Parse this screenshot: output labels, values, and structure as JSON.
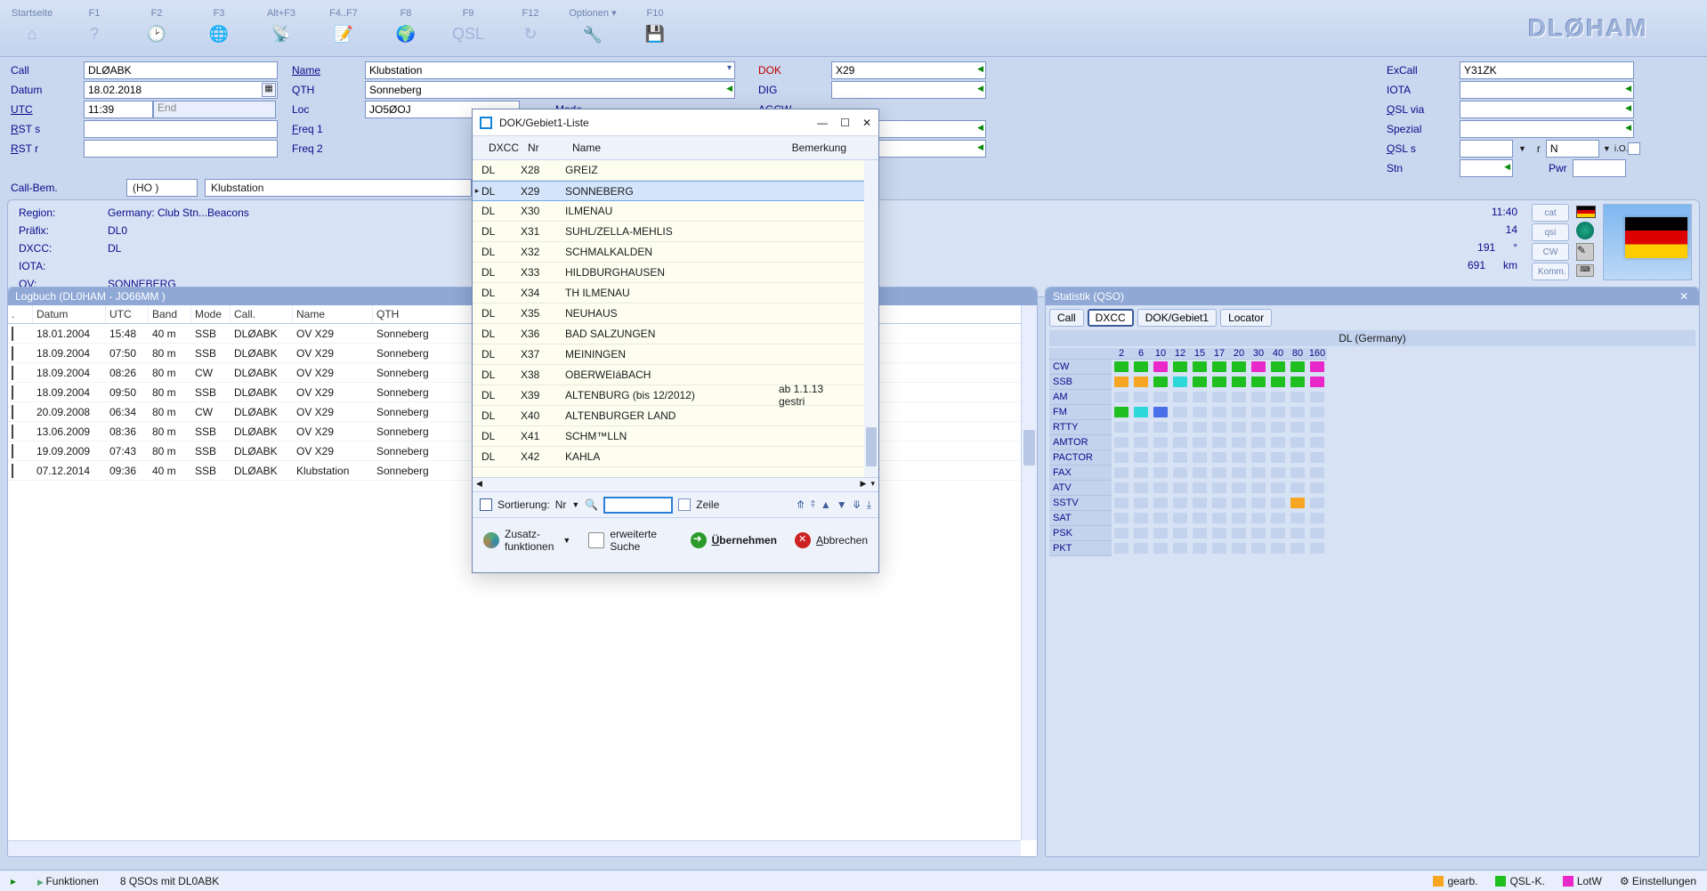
{
  "brand": "DLØHAM",
  "toolbar": [
    {
      "key": "Startseite",
      "icon": "⌂"
    },
    {
      "key": "F1",
      "icon": "?"
    },
    {
      "key": "F2",
      "icon": "🕑"
    },
    {
      "key": "F3",
      "icon": "🌐"
    },
    {
      "key": "Alt+F3",
      "icon": "📡"
    },
    {
      "key": "F4..F7",
      "icon": "📝"
    },
    {
      "key": "F8",
      "icon": "🌍"
    },
    {
      "key": "F9",
      "icon": "QSL"
    },
    {
      "key": "F12",
      "icon": "↻"
    },
    {
      "key": "Optionen ▾",
      "icon": "🔧"
    },
    {
      "key": "F10",
      "icon": "💾"
    }
  ],
  "form": {
    "call": {
      "label": "Call",
      "value": "DLØABK"
    },
    "datum": {
      "label": "Datum",
      "value": "18.02.2018"
    },
    "utc": {
      "label": "UTC",
      "value": "11:39",
      "end": "End"
    },
    "rsts": {
      "label": "RST s",
      "value": ""
    },
    "rstr": {
      "label": "RST r",
      "value": ""
    },
    "name": {
      "label": "Name",
      "value": "Klubstation"
    },
    "qth": {
      "label": "QTH",
      "value": "Sonneberg"
    },
    "loc": {
      "label": "Loc",
      "value": "JO5ØOJ"
    },
    "mode": {
      "label": "Mode",
      "value": ""
    },
    "freq1": {
      "label": "Freq 1",
      "value": ""
    },
    "freq2": {
      "label": "Freq 2",
      "value": ""
    },
    "dok": {
      "label": "DOK",
      "value": "X29"
    },
    "dig": {
      "label": "DIG",
      "value": ""
    },
    "agcw": {
      "label": "AGCW",
      "value": ""
    },
    "excall": {
      "label": "ExCall",
      "value": "Y31ZK"
    },
    "iota": {
      "label": "IOTA",
      "value": ""
    },
    "qslvia": {
      "label": "QSL via",
      "value": ""
    },
    "spezial": {
      "label": "Spezial",
      "value": ""
    },
    "qsls": {
      "label": "QSL s",
      "r": "r",
      "n": "N",
      "io": "i.O."
    },
    "stn": {
      "label": "Stn",
      "pwr": "Pwr"
    }
  },
  "callbem": {
    "label": "Call-Bem.",
    "ho": "(HO )",
    "klub": "Klubstation"
  },
  "info": {
    "region_l": "Region:",
    "region_v": "Germany: Club Stn...Beacons",
    "prafix_l": "Präfix:",
    "prafix_v": "DL0",
    "dxcc_l": "DXCC:",
    "dxcc_v": "DL",
    "iota_l": "IOTA:",
    "iota_v": "",
    "ov_l": "OV:",
    "ov_v": "SONNEBERG",
    "time": "11:40",
    "v1": "14",
    "deg": "191",
    "deg_u": "°",
    "km": "691",
    "km_u": "km",
    "btns": [
      "cat",
      "qsi",
      "CW",
      "Komm."
    ]
  },
  "log": {
    "title": "Logbuch  (DL0HAM - JO66MM )",
    "heads": [
      ".",
      "Datum",
      "UTC",
      "Band",
      "Mode",
      "Call.",
      "Name",
      "QTH"
    ],
    "rows": [
      {
        "d": "18.01.2004",
        "u": "15:48",
        "b": "40 m",
        "m": "SSB",
        "c": "DLØABK",
        "n": "OV X29",
        "q": "Sonneberg"
      },
      {
        "d": "18.09.2004",
        "u": "07:50",
        "b": "80 m",
        "m": "SSB",
        "c": "DLØABK",
        "n": "OV X29",
        "q": "Sonneberg"
      },
      {
        "d": "18.09.2004",
        "u": "08:26",
        "b": "80 m",
        "m": "CW",
        "c": "DLØABK",
        "n": "OV X29",
        "q": "Sonneberg"
      },
      {
        "d": "18.09.2004",
        "u": "09:50",
        "b": "80 m",
        "m": "SSB",
        "c": "DLØABK",
        "n": "OV X29",
        "q": "Sonneberg"
      },
      {
        "d": "20.09.2008",
        "u": "06:34",
        "b": "80 m",
        "m": "CW",
        "c": "DLØABK",
        "n": "OV X29",
        "q": "Sonneberg"
      },
      {
        "d": "13.06.2009",
        "u": "08:36",
        "b": "80 m",
        "m": "SSB",
        "c": "DLØABK",
        "n": "OV X29",
        "q": "Sonneberg"
      },
      {
        "d": "19.09.2009",
        "u": "07:43",
        "b": "80 m",
        "m": "SSB",
        "c": "DLØABK",
        "n": "OV X29",
        "q": "Sonneberg"
      },
      {
        "d": "07.12.2014",
        "u": "09:36",
        "b": "40 m",
        "m": "SSB",
        "c": "DLØABK",
        "n": "Klubstation",
        "q": "Sonneberg"
      }
    ]
  },
  "stat": {
    "title": "Statistik (QSO)",
    "tabs": [
      "Call",
      "DXCC",
      "DOK/Gebiet1",
      "Locator"
    ],
    "active": 1,
    "dl": "DL (Germany)",
    "bands": [
      "2",
      "6",
      "10",
      "12",
      "15",
      "17",
      "20",
      "30",
      "40",
      "80",
      "160"
    ],
    "modes": [
      "CW",
      "SSB",
      "AM",
      "FM",
      "RTTY",
      "AMTOR",
      "PACTOR",
      "FAX",
      "ATV",
      "SSTV",
      "SAT",
      "PSK",
      "PKT"
    ],
    "cells": {
      "CW": [
        "g",
        "g",
        "m",
        "g",
        "g",
        "g",
        "g",
        "m",
        "g",
        "g",
        "m"
      ],
      "SSB": [
        "o",
        "o",
        "g",
        "c",
        "g",
        "g",
        "g",
        "g",
        "g",
        "g",
        "m"
      ],
      "AM": [
        "e",
        "e",
        "e",
        "e",
        "e",
        "e",
        "e",
        "e",
        "e",
        "e",
        "e"
      ],
      "FM": [
        "g",
        "c",
        "b",
        "e",
        "e",
        "e",
        "e",
        "e",
        "e",
        "e",
        "e"
      ],
      "RTTY": [
        "e",
        "e",
        "e",
        "e",
        "e",
        "e",
        "e",
        "e",
        "e",
        "e",
        "e"
      ],
      "AMTOR": [
        "e",
        "e",
        "e",
        "e",
        "e",
        "e",
        "e",
        "e",
        "e",
        "e",
        "e"
      ],
      "PACTOR": [
        "e",
        "e",
        "e",
        "e",
        "e",
        "e",
        "e",
        "e",
        "e",
        "e",
        "e"
      ],
      "FAX": [
        "e",
        "e",
        "e",
        "e",
        "e",
        "e",
        "e",
        "e",
        "e",
        "e",
        "e"
      ],
      "ATV": [
        "e",
        "e",
        "e",
        "e",
        "e",
        "e",
        "e",
        "e",
        "e",
        "e",
        "e"
      ],
      "SSTV": [
        "e",
        "e",
        "e",
        "e",
        "e",
        "e",
        "e",
        "e",
        "e",
        "o",
        "e"
      ],
      "SAT": [
        "e",
        "e",
        "e",
        "e",
        "e",
        "e",
        "e",
        "e",
        "e",
        "e",
        "e"
      ],
      "PSK": [
        "e",
        "e",
        "e",
        "e",
        "e",
        "e",
        "e",
        "e",
        "e",
        "e",
        "e"
      ],
      "PKT": [
        "e",
        "e",
        "e",
        "e",
        "e",
        "e",
        "e",
        "e",
        "e",
        "e",
        "e"
      ]
    }
  },
  "dialog": {
    "title": "DOK/Gebiet1-Liste",
    "heads": {
      "dxcc": "DXCC",
      "nr": "Nr",
      "name": "Name",
      "bem": "Bemerkung"
    },
    "rows": [
      {
        "x": "DL",
        "n": "X28",
        "name": "GREIZ",
        "b": ""
      },
      {
        "x": "DL",
        "n": "X29",
        "name": "SONNEBERG",
        "b": "",
        "sel": true
      },
      {
        "x": "DL",
        "n": "X30",
        "name": "ILMENAU",
        "b": ""
      },
      {
        "x": "DL",
        "n": "X31",
        "name": "SUHL/ZELLA-MEHLIS",
        "b": ""
      },
      {
        "x": "DL",
        "n": "X32",
        "name": "SCHMALKALDEN",
        "b": ""
      },
      {
        "x": "DL",
        "n": "X33",
        "name": "HILDBURGHAUSEN",
        "b": ""
      },
      {
        "x": "DL",
        "n": "X34",
        "name": "TH ILMENAU",
        "b": ""
      },
      {
        "x": "DL",
        "n": "X35",
        "name": "NEUHAUS",
        "b": ""
      },
      {
        "x": "DL",
        "n": "X36",
        "name": "BAD SALZUNGEN",
        "b": ""
      },
      {
        "x": "DL",
        "n": "X37",
        "name": "MEININGEN",
        "b": ""
      },
      {
        "x": "DL",
        "n": "X38",
        "name": "OBERWEIáBACH",
        "b": ""
      },
      {
        "x": "DL",
        "n": "X39",
        "name": "ALTENBURG (bis 12/2012)",
        "b": "ab 1.1.13 gestri"
      },
      {
        "x": "DL",
        "n": "X40",
        "name": "ALTENBURGER LAND",
        "b": ""
      },
      {
        "x": "DL",
        "n": "X41",
        "name": "SCHM™LLN",
        "b": ""
      },
      {
        "x": "DL",
        "n": "X42",
        "name": "KAHLA",
        "b": ""
      }
    ],
    "sort": {
      "label": "Sortierung:",
      "nr": "Nr",
      "zeile": "Zeile"
    },
    "btns": {
      "zf1": "Zusatz-",
      "zf2": "funktionen",
      "es1": "erweiterte",
      "es2": "Suche",
      "ok": "Übernehmen",
      "ab": "Abbrechen"
    }
  },
  "status": {
    "funk": "Funktionen",
    "count": "8 QSOs mit DL0ABK",
    "legend": [
      {
        "c": "#f6a623",
        "t": "gearb."
      },
      {
        "c": "#1fbf1f",
        "t": "QSL-K."
      },
      {
        "c": "#e828c8",
        "t": "LotW"
      }
    ],
    "einst": "Einstellungen"
  }
}
